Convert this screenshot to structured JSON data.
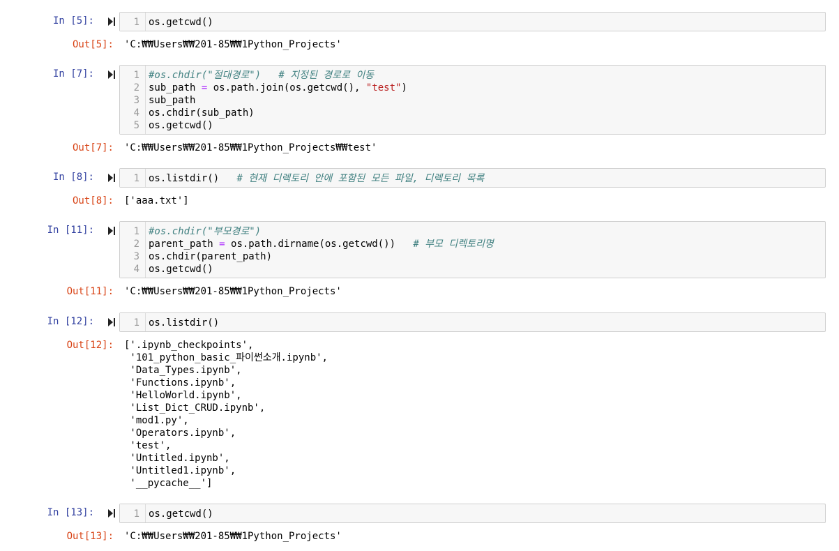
{
  "cells": [
    {
      "in_prompt": "In [5]:",
      "out_prompt": "Out[5]:",
      "lines": [
        {
          "n": "1",
          "parts": [
            {
              "t": "os.getcwd()",
              "c": ""
            }
          ]
        }
      ],
      "output": [
        "'C:₩₩Users₩₩201-85₩₩1Python_Projects'"
      ]
    },
    {
      "in_prompt": "In [7]:",
      "out_prompt": "Out[7]:",
      "lines": [
        {
          "n": "1",
          "parts": [
            {
              "t": "#os.chdir(\"절대경로\")   # 지정된 경로로 이동",
              "c": "cm"
            }
          ]
        },
        {
          "n": "2",
          "parts": [
            {
              "t": "sub_path ",
              "c": ""
            },
            {
              "t": "=",
              "c": "op"
            },
            {
              "t": " os.path.join(os.getcwd(), ",
              "c": ""
            },
            {
              "t": "\"test\"",
              "c": "str"
            },
            {
              "t": ")",
              "c": ""
            }
          ]
        },
        {
          "n": "3",
          "parts": [
            {
              "t": "sub_path",
              "c": ""
            }
          ]
        },
        {
          "n": "4",
          "parts": [
            {
              "t": "os.chdir(sub_path)",
              "c": ""
            }
          ]
        },
        {
          "n": "5",
          "parts": [
            {
              "t": "os.getcwd()",
              "c": ""
            }
          ]
        }
      ],
      "output": [
        "'C:₩₩Users₩₩201-85₩₩1Python_Projects₩₩test'"
      ]
    },
    {
      "in_prompt": "In [8]:",
      "out_prompt": "Out[8]:",
      "lines": [
        {
          "n": "1",
          "parts": [
            {
              "t": "os.listdir()   ",
              "c": ""
            },
            {
              "t": "# 현재 디렉토리 안에 포함된 모든 파일, 디렉토리 목록",
              "c": "cm"
            }
          ]
        }
      ],
      "output": [
        "['aaa.txt']"
      ]
    },
    {
      "in_prompt": "In [11]:",
      "out_prompt": "Out[11]:",
      "lines": [
        {
          "n": "1",
          "parts": [
            {
              "t": "#os.chdir(\"부모경로\")",
              "c": "cm"
            }
          ]
        },
        {
          "n": "2",
          "parts": [
            {
              "t": "parent_path ",
              "c": ""
            },
            {
              "t": "=",
              "c": "op"
            },
            {
              "t": " os.path.dirname(os.getcwd())   ",
              "c": ""
            },
            {
              "t": "# 부모 디렉토리명",
              "c": "cm"
            }
          ]
        },
        {
          "n": "3",
          "parts": [
            {
              "t": "os.chdir(parent_path)",
              "c": ""
            }
          ]
        },
        {
          "n": "4",
          "parts": [
            {
              "t": "os.getcwd()",
              "c": ""
            }
          ]
        }
      ],
      "output": [
        "'C:₩₩Users₩₩201-85₩₩1Python_Projects'"
      ]
    },
    {
      "in_prompt": "In [12]:",
      "out_prompt": "Out[12]:",
      "lines": [
        {
          "n": "1",
          "parts": [
            {
              "t": "os.listdir()",
              "c": ""
            }
          ]
        }
      ],
      "output": [
        "['.ipynb_checkpoints',",
        " '101_python_basic_파이썬소개.ipynb',",
        " 'Data_Types.ipynb',",
        " 'Functions.ipynb',",
        " 'HelloWorld.ipynb',",
        " 'List_Dict_CRUD.ipynb',",
        " 'mod1.py',",
        " 'Operators.ipynb',",
        " 'test',",
        " 'Untitled.ipynb',",
        " 'Untitled1.ipynb',",
        " '__pycache__']"
      ]
    },
    {
      "in_prompt": "In [13]:",
      "out_prompt": "Out[13]:",
      "lines": [
        {
          "n": "1",
          "parts": [
            {
              "t": "os.getcwd()",
              "c": ""
            }
          ]
        }
      ],
      "output": [
        "'C:₩₩Users₩₩201-85₩₩1Python_Projects'"
      ]
    }
  ],
  "colors": {
    "in_prompt": "#303f9f",
    "out_prompt": "#d84315",
    "comment": "#408080",
    "string": "#ba2121",
    "operator": "#aa22ff"
  },
  "icons": {
    "run": "run-cell-icon"
  }
}
